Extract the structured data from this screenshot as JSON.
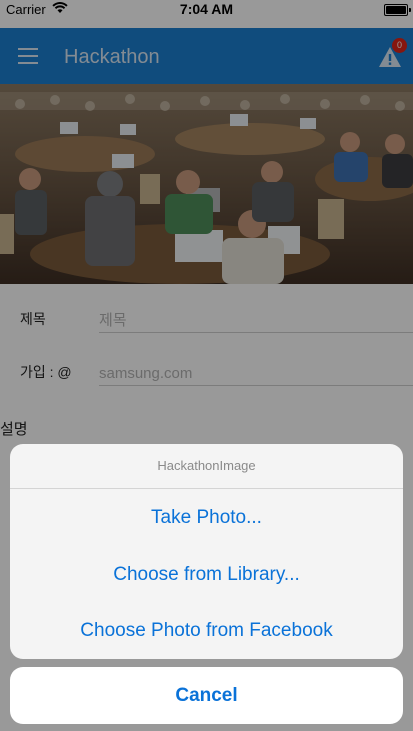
{
  "status_bar": {
    "carrier": "Carrier",
    "time": "7:04 AM",
    "battery_level": 1.0
  },
  "app_bar": {
    "title": "Hackathon",
    "menu_icon": "hamburger-icon",
    "alert_icon": "warning-icon",
    "alert_badge": "0"
  },
  "hero_image": {
    "description": "Hackathon event photo",
    "icon": "photo"
  },
  "form": {
    "title_label": "제목",
    "title_placeholder": "제목",
    "join_label": "가입 : @",
    "join_placeholder": "samsung.com",
    "description_label": "설명"
  },
  "action_sheet": {
    "title": "HackathonImage",
    "options": [
      "Take Photo...",
      "Choose from Library...",
      "Choose Photo from Facebook"
    ],
    "cancel_label": "Cancel"
  },
  "colors": {
    "app_bar": "#1b7fd0",
    "action_text": "#0a72d8",
    "badge": "#e0261a"
  }
}
